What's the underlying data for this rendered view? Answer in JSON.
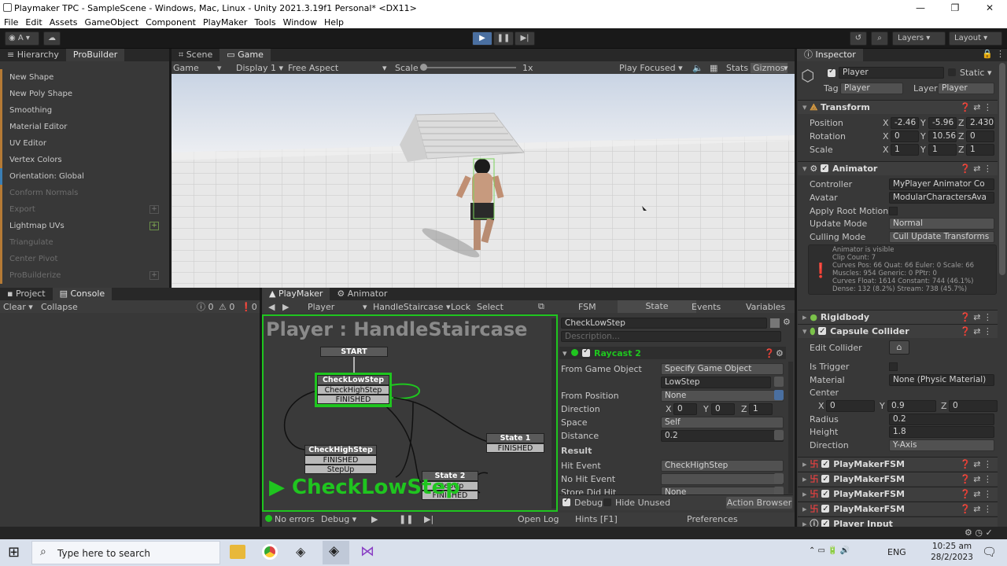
{
  "window": {
    "title": "Playmaker TPC - SampleScene - Windows, Mac, Linux - Unity 2021.3.19f1 Personal* <DX11>",
    "min": "—",
    "max": "❐",
    "close": "✕"
  },
  "menu": [
    "File",
    "Edit",
    "Assets",
    "GameObject",
    "Component",
    "PlayMaker",
    "Tools",
    "Window",
    "Help"
  ],
  "toolbar": {
    "account": "A",
    "layers": "Layers",
    "layout": "Layout"
  },
  "left_tabs": {
    "hierarchy": "Hierarchy",
    "probuilder": "ProBuilder"
  },
  "probuilder_items": [
    {
      "label": "New Shape",
      "dim": false
    },
    {
      "label": "New Poly Shape",
      "dim": false
    },
    {
      "label": "Smoothing",
      "dim": false
    },
    {
      "label": "Material Editor",
      "dim": false
    },
    {
      "label": "UV Editor",
      "dim": false
    },
    {
      "label": "Vertex Colors",
      "dim": false
    },
    {
      "label": "Orientation: Global",
      "dim": false
    },
    {
      "label": "Conform Normals",
      "dim": true
    },
    {
      "label": "Export",
      "dim": true
    },
    {
      "label": "Lightmap UVs",
      "dim": false
    },
    {
      "label": "Triangulate",
      "dim": true
    },
    {
      "label": "Center Pivot",
      "dim": true
    },
    {
      "label": "ProBuilderize",
      "dim": true
    }
  ],
  "view_tabs": {
    "scene": "Scene",
    "game": "Game"
  },
  "gamebar": {
    "mode": "Game",
    "display": "Display 1",
    "aspect": "Free Aspect",
    "scale_label": "Scale",
    "scale_value": "1x",
    "play_focused": "Play Focused",
    "stats": "Stats",
    "gizmos": "Gizmos"
  },
  "bottom_tabs": {
    "project": "Project",
    "console": "Console",
    "playmaker": "PlayMaker",
    "animator": "Animator"
  },
  "console": {
    "clear": "Clear",
    "collapse": "Collapse",
    "c1": "0",
    "c2": "0",
    "c3": "0"
  },
  "playmaker": {
    "go": "Player",
    "fsm": "HandleStaircase",
    "lock": "Lock",
    "select": "Select",
    "graph_title": "Player : HandleStaircase",
    "current_state": "CheckLowStep",
    "start": "START",
    "states": {
      "low_title": "CheckLowStep",
      "low_t1": "CheckHighStep",
      "low_t2": "FINISHED",
      "high_title": "CheckHighStep",
      "high_t1": "FINISHED",
      "high_t2": "StepUp",
      "s1_title": "State 1",
      "s1_t1": "FINISHED",
      "s2_title": "State 2",
      "s2_t1": "StepUp",
      "s2_t2": "FINISHED"
    },
    "tabs": [
      "FSM",
      "State",
      "Events",
      "Variables"
    ],
    "state_name": "CheckLowStep",
    "description": "Description...",
    "action": "Raycast 2",
    "rows": [
      {
        "label": "From Game Object",
        "value": "Specify Game Object"
      },
      {
        "label": "",
        "value": "LowStep"
      },
      {
        "label": "From Position",
        "value": "None"
      },
      {
        "label": "Direction",
        "value": ""
      },
      {
        "label": "Space",
        "value": "Self"
      },
      {
        "label": "Distance",
        "value": "0.2"
      },
      {
        "label": "Result",
        "value": ""
      },
      {
        "label": "Hit Event",
        "value": "CheckHighStep"
      },
      {
        "label": "No Hit Event",
        "value": ""
      },
      {
        "label": "Store Did Hit",
        "value": "None"
      }
    ],
    "direction": {
      "x": "0",
      "y": "0",
      "z": "1"
    },
    "debug": "Debug",
    "hide_unused": "Hide Unused",
    "action_browser": "Action Browser",
    "status": {
      "errors": "No errors",
      "debug": "Debug",
      "open_log": "Open Log",
      "hints": "Hints [F1]",
      "preferences": "Preferences"
    }
  },
  "inspector": {
    "tab": "Inspector",
    "name": "Player",
    "static": "Static",
    "tag_label": "Tag",
    "tag": "Player",
    "layer_label": "Layer",
    "layer": "Player",
    "transform": {
      "title": "Transform",
      "position": [
        "-2.46",
        "-5.96",
        "2.430"
      ],
      "rotation": [
        "0",
        "10.56",
        "0"
      ],
      "scale": [
        "1",
        "1",
        "1"
      ],
      "pos_label": "Position",
      "rot_label": "Rotation",
      "scale_label": "Scale"
    },
    "animator": {
      "title": "Animator",
      "controller_label": "Controller",
      "controller": "MyPlayer Animator Co",
      "avatar_label": "Avatar",
      "avatar": "ModularCharactersAva",
      "apply_root": "Apply Root Motion",
      "update_label": "Update Mode",
      "update": "Normal",
      "culling_label": "Culling Mode",
      "culling": "Cull Update Transforms",
      "info": [
        "Animator is visible",
        "Clip Count: 7",
        "Curves Pos: 66 Quat: 66 Euler: 0 Scale: 66",
        "Muscles: 954 Generic: 0 PPtr: 0",
        "Curves Float: 1614 Constant: 744 (46.1%)",
        "Dense: 132 (8.2%) Stream: 738 (45.7%)"
      ]
    },
    "rigidbody": "Rigidbody",
    "capsule": {
      "title": "Capsule Collider",
      "edit": "Edit Collider",
      "trigger": "Is Trigger",
      "material_label": "Material",
      "material": "None (Physic Material)",
      "center_label": "Center",
      "center": [
        "0",
        "0.9",
        "0"
      ],
      "radius_label": "Radius",
      "radius": "0.2",
      "height_label": "Height",
      "height": "1.8",
      "direction_label": "Direction",
      "direction": "Y-Axis"
    },
    "fsms": [
      "PlayMakerFSM",
      "PlayMakerFSM",
      "PlayMakerFSM",
      "PlayMakerFSM"
    ],
    "player_input": "Player Input"
  },
  "taskbar": {
    "search": "Type here to search",
    "lang": "ENG",
    "time": "10:25 am",
    "date": "28/2/2023"
  }
}
